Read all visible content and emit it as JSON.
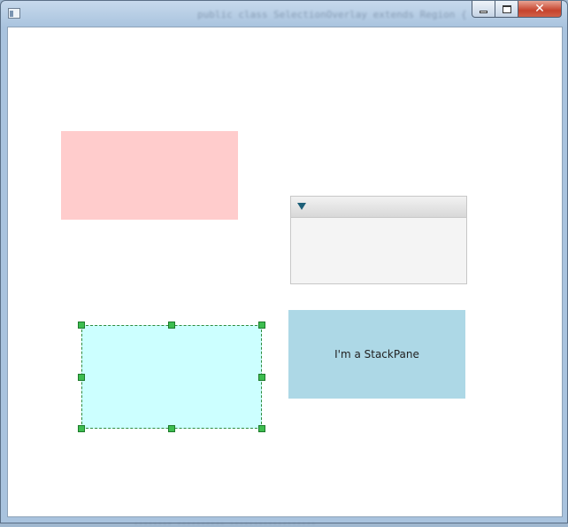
{
  "window": {
    "background_title_blur": "public class SelectionOverlay extends Region {",
    "bottom_blur": "........    ..........  ..................",
    "caption": {
      "minimize_icon": "minimize-icon",
      "maximize_icon": "maximize-icon",
      "close_glyph": "✕"
    }
  },
  "canvas": {
    "pink_rect": {
      "color": "#ffcccc"
    },
    "titled_pane": {
      "arrow_icon": "triangle-down-icon",
      "title": ""
    },
    "selected_rect": {
      "color": "#ccffff",
      "handle_color": "#3dbd4f"
    },
    "stackpane": {
      "label": "I'm a StackPane",
      "color": "#add8e6"
    }
  }
}
